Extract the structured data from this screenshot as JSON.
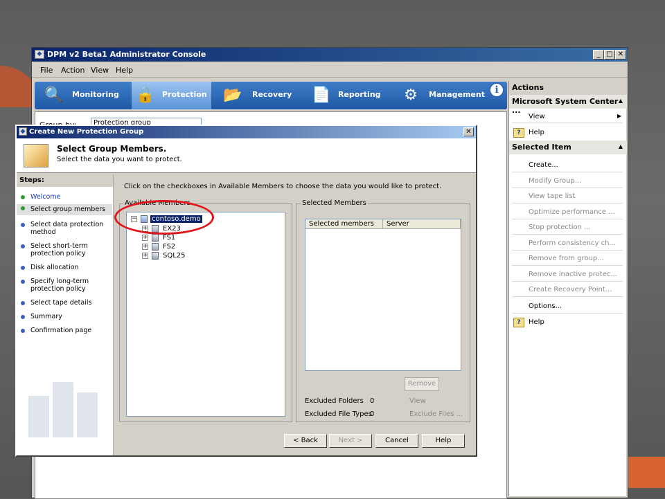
{
  "main_window": {
    "title": "DPM v2 Beta1 Administrator Console",
    "minimize": "_",
    "maximize": "□",
    "close": "✕"
  },
  "menu": [
    "File",
    "Action",
    "View",
    "Help"
  ],
  "nav_tabs": [
    {
      "label": "Monitoring",
      "icon": "monitoring-icon"
    },
    {
      "label": "Protection",
      "icon": "protection-lock-icon",
      "active": true
    },
    {
      "label": "Recovery",
      "icon": "recovery-folder-icon"
    },
    {
      "label": "Reporting",
      "icon": "reporting-document-icon"
    },
    {
      "label": "Management",
      "icon": "management-gear-icon"
    }
  ],
  "group_by": {
    "label": "Group by:",
    "value": "Protection group"
  },
  "actions": {
    "header": "Actions",
    "section1_header": "Microsoft System Center ...",
    "view": "View",
    "help1": "Help",
    "section2_header": "Selected Item",
    "items": [
      {
        "label": "Create...",
        "enabled": true
      },
      {
        "label": "Modify Group...",
        "enabled": false
      },
      {
        "label": "View tape list",
        "enabled": false
      },
      {
        "label": "Optimize performance ...",
        "enabled": false
      },
      {
        "label": "Stop protection ...",
        "enabled": false
      },
      {
        "label": "Perform consistency ch...",
        "enabled": false
      },
      {
        "label": "Remove from group...",
        "enabled": false
      },
      {
        "label": "Remove inactive protec...",
        "enabled": false
      },
      {
        "label": "Create Recovery Point...",
        "enabled": false
      },
      {
        "label": "Options...",
        "enabled": true
      }
    ],
    "help2": "Help"
  },
  "dialog": {
    "title": "Create New Protection Group",
    "close": "✕",
    "heading": "Select Group Members.",
    "subheading": "Select the data you want to protect.",
    "steps_title": "Steps:",
    "steps": [
      "Welcome",
      "Select group members",
      "Select data protection method",
      "Select short-term protection policy",
      "Disk allocation",
      "Specify long-term protection policy",
      "Select tape details",
      "Summary",
      "Confirmation page"
    ],
    "instruction": "Click on the checkboxes in Available Members to choose the data you would like to protect.",
    "available_members": {
      "legend": "Available Members",
      "root": "contoso.demo",
      "children": [
        "EX23",
        "FS1",
        "FS2",
        "SQL25"
      ]
    },
    "selected_members": {
      "legend": "Selected Members",
      "columns": [
        "Selected members",
        "Server"
      ],
      "remove": "Remove",
      "excluded_folders_label": "Excluded Folders",
      "excluded_folders_value": "0",
      "excluded_folders_link": "View",
      "excluded_types_label": "Excluded File Types",
      "excluded_types_value": "0",
      "excluded_types_link": "Exclude Files ..."
    },
    "buttons": {
      "back": "< Back",
      "next": "Next >",
      "cancel": "Cancel",
      "help": "Help"
    }
  },
  "colors": {
    "accent": "#1f58a6",
    "highlight_ellipse": "#e0161b",
    "selection": "#0a246a"
  }
}
